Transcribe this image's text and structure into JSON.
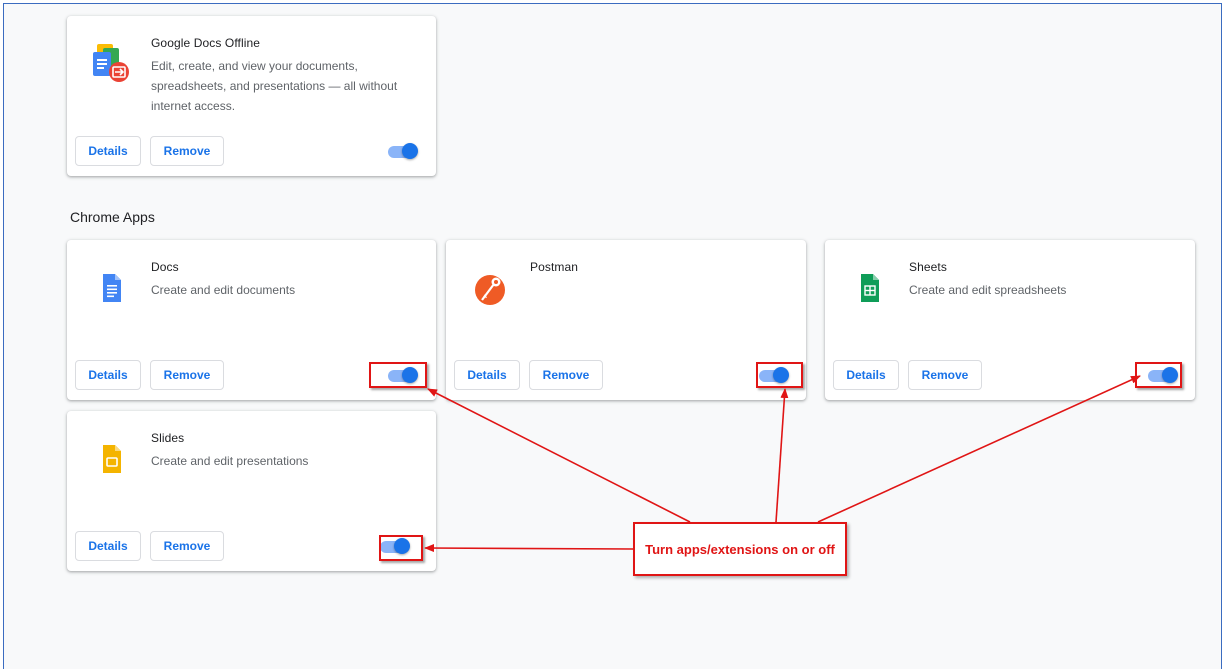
{
  "section": {
    "chrome_apps_title": "Chrome Apps"
  },
  "cards": {
    "docs_offline": {
      "title": "Google Docs Offline",
      "description": "Edit, create, and view your documents, spreadsheets, and presentations — all without internet access.",
      "details": "Details",
      "remove": "Remove",
      "icon": "docs-offline-icon",
      "enabled": true
    },
    "docs": {
      "title": "Docs",
      "description": "Create and edit documents",
      "details": "Details",
      "remove": "Remove",
      "icon": "docs-icon",
      "enabled": true
    },
    "postman": {
      "title": "Postman",
      "description": "",
      "details": "Details",
      "remove": "Remove",
      "icon": "postman-icon",
      "enabled": true
    },
    "sheets": {
      "title": "Sheets",
      "description": "Create and edit spreadsheets",
      "details": "Details",
      "remove": "Remove",
      "icon": "sheets-icon",
      "enabled": true
    },
    "slides": {
      "title": "Slides",
      "description": "Create and edit presentations",
      "details": "Details",
      "remove": "Remove",
      "icon": "slides-icon",
      "enabled": true
    }
  },
  "annotation": {
    "callout_text": "Turn apps/extensions on or off"
  },
  "colors": {
    "accent": "#1a73e8",
    "toggle_track": "#8ab4f8",
    "annotation_red": "#e01515",
    "page_background": "#f8f9fa",
    "frame_border": "#3b6cc0"
  }
}
